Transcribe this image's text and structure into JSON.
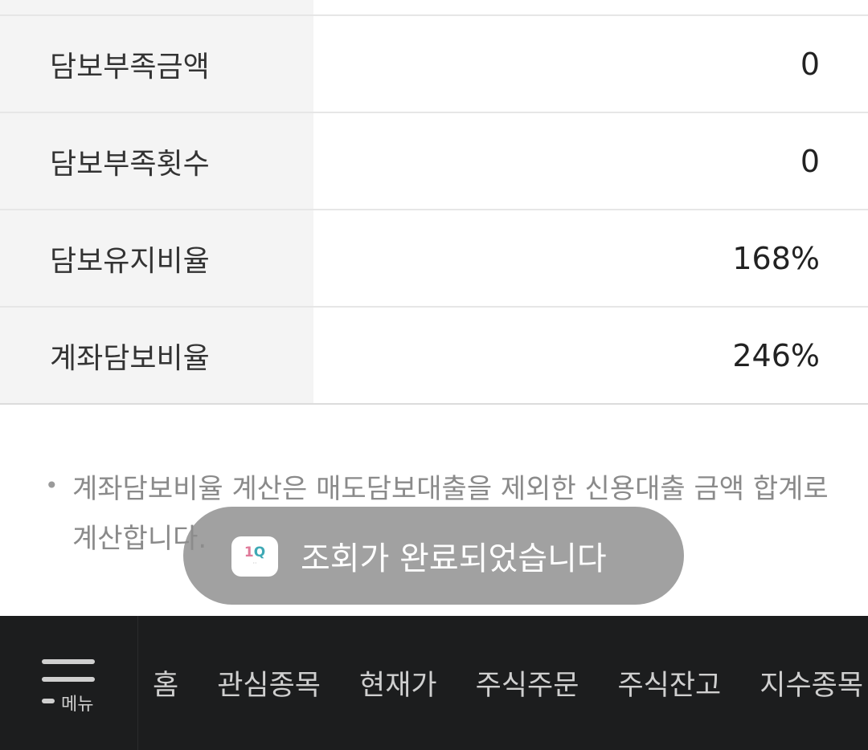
{
  "table": {
    "rows": [
      {
        "label": "담보부족금액",
        "value": "0"
      },
      {
        "label": "담보부족횟수",
        "value": "0"
      },
      {
        "label": "담보유지비율",
        "value": "168%"
      },
      {
        "label": "계좌담보비율",
        "value": "246%"
      }
    ]
  },
  "note": {
    "bullet": "•",
    "text": "계좌담보비율 계산은 매도담보대출을 제외한 신용대출 금액 합계로 계산합니다."
  },
  "toast": {
    "message": "조회가 완료되었습니다",
    "icon": "1q-app-icon"
  },
  "bottom_nav": {
    "menu_label": "메뉴",
    "items": [
      "홈",
      "관심종목",
      "현재가",
      "주식주문",
      "주식잔고",
      "지수종목"
    ]
  },
  "colors": {
    "label_bg": "#f4f4f4",
    "nav_bg": "#1c1d1e",
    "toast_bg": "#8c8c8c"
  }
}
